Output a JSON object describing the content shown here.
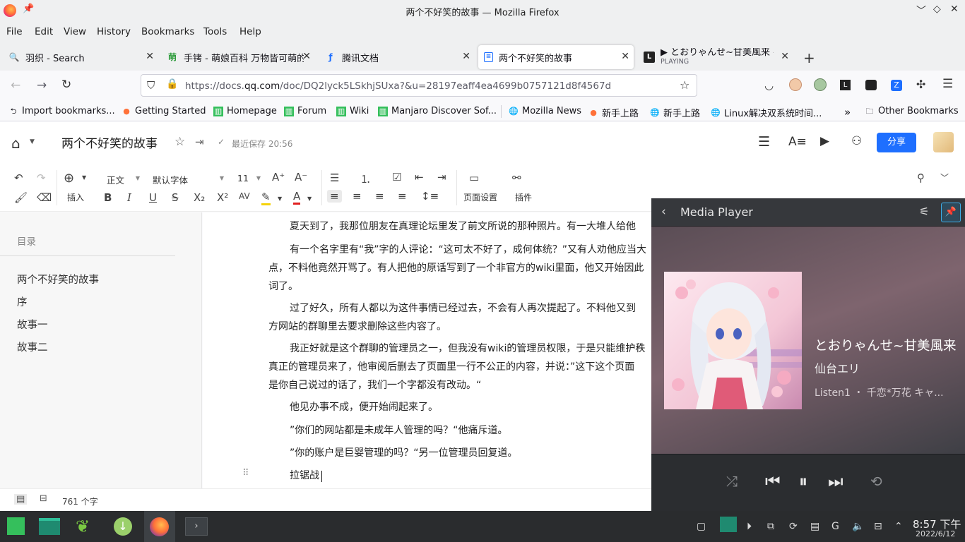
{
  "window": {
    "title": "两个不好笑的故事 — Mozilla Firefox"
  },
  "menu": [
    "File",
    "Edit",
    "View",
    "History",
    "Bookmarks",
    "Tools",
    "Help"
  ],
  "tabs": [
    {
      "label": "羽织 - Search",
      "favicon": "search-icon"
    },
    {
      "label": "手铐 - 萌娘百科 万物皆可萌的",
      "favicon": "moegirl-icon"
    },
    {
      "label": "腾讯文档",
      "favicon": "tencent-docs-icon"
    },
    {
      "label": "两个不好笑的故事",
      "favicon": "docs-icon"
    },
    {
      "label": "▶ とおりゃんせ~甘美風来 -",
      "sublabel": "PLAYING",
      "favicon": "media-icon"
    }
  ],
  "urlbar": {
    "prefix": "https://docs.",
    "domain": "qq.com",
    "rest": "/doc/DQ2lyck5LSkhjSUxa?&u=28197eaff4ea4699b0757121d8f4567d"
  },
  "bookmarks": [
    "Import bookmarks...",
    "Getting Started",
    "Homepage",
    "Forum",
    "Wiki",
    "Manjaro Discover Sof...",
    "Mozilla News",
    "新手上路",
    "新手上路",
    "Linux解决双系统时间...",
    "Other Bookmarks"
  ],
  "doc": {
    "title": "两个不好笑的故事",
    "saved": "最近保存 20:56",
    "share": "分享"
  },
  "toolbar": {
    "insert": "插入",
    "style": "正文",
    "font": "默认字体",
    "size": "11",
    "page_setup": "页面设置",
    "plugins": "插件"
  },
  "outline": {
    "title": "目录",
    "items": [
      "两个不好笑的故事",
      "序",
      "故事一",
      "故事二"
    ]
  },
  "paragraphs": [
    "夏天到了，我那位朋友在真理论坛里发了前文所说的那种照片。有一大堆人给他",
    "有一个名字里有“我”字的人评论：“这可太不好了，成何体统？”又有人劝他应当大",
    "点，不料他竟然开骂了。有人把他的原话写到了一个非官方的wiki里面，他又开始因此",
    "词了。",
    "过了好久，所有人都以为这件事情已经过去，不会有人再次提起了。不料他又到",
    "方网站的群聊里去要求删除这些内容了。",
    "我正好就是这个群聊的管理员之一，但我没有wiki的管理员权限，于是只能维护秩",
    "真正的管理员来了，他审阅后删去了页面里一行不公正的内容，并说：”这下这个页面",
    "是你自己说过的话了，我们一个字都没有改动。“",
    "他见办事不成，便开始闹起来了。",
    "”你们的网站都是未成年人管理的吗？“他痛斥道。",
    "”你的账户是巨婴管理的吗？“另一位管理员回复道。",
    "拉锯战"
  ],
  "status": {
    "word_count": "761 个字"
  },
  "media_player": {
    "header": "Media Player",
    "track_title": "とおりゃんせ~甘美風来",
    "artist": "仙台エリ",
    "album": "Listen1 ・ 千恋*万花 キャ..."
  },
  "clock": {
    "time": "8:57 下午",
    "date": "2022/6/12"
  }
}
